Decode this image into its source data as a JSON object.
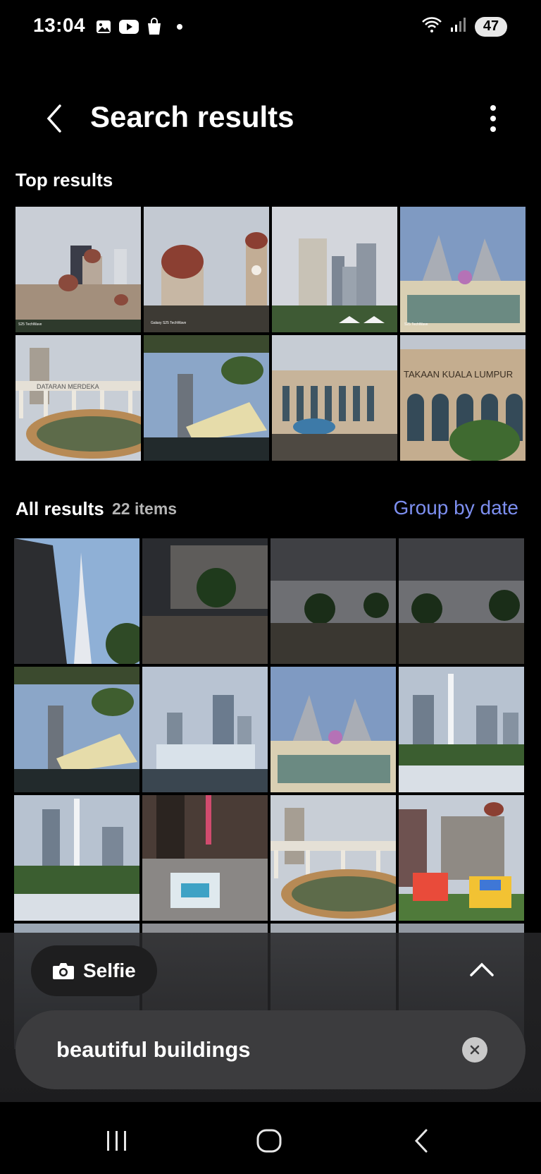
{
  "status": {
    "time": "13:04",
    "battery": "47",
    "left_icons": [
      "gallery-icon",
      "youtube-icon",
      "shop-icon",
      "dot-icon"
    ],
    "right_icons": [
      "wifi-icon",
      "signal-icon"
    ]
  },
  "header": {
    "title": "Search results",
    "back_icon": "chevron-left-icon",
    "more_icon": "more-vertical-icon"
  },
  "top_results": {
    "title": "Top results",
    "photos": [
      "Sultan Abdul Samad building with clock tower",
      "Red dome and clock tower",
      "City skyscrapers",
      "Petronas Twin Towers from below",
      "Dataran Merdeka colonnade and fountain",
      "Modern buildings with palm trees",
      "Perpustakaan Kuala Lumpur facade",
      "Perpustakaan Kuala Lumpur arches"
    ],
    "watermark": "Galaxy S25 TechWave"
  },
  "all_results": {
    "title": "All results",
    "count": "22 items",
    "group_label": "Group by date",
    "photos": [
      "Tower spire and angular building",
      "Night plaza with mall",
      "Night plaza with trees",
      "Night plaza with trees 2",
      "Modern buildings with palm trees",
      "KLCC fountain",
      "Petronas Twin Towers",
      "Fountain with skyline",
      "Fountain with skyline 2",
      "Mall interior atrium",
      "Dataran Merdeka colonnade",
      "Bouncy castle near clock tower",
      "Partial row 1",
      "Partial row 2",
      "Partial row 3",
      "Partial row 4"
    ]
  },
  "bottom": {
    "chip_label": "Selfie",
    "chip_icon": "camera-icon",
    "expand_icon": "chevron-up-icon",
    "search_value": "beautiful buildings",
    "clear_icon": "clear-icon"
  },
  "navbar": {
    "icons": [
      "recent-apps-icon",
      "home-icon",
      "back-icon"
    ]
  },
  "colors": {
    "background": "#000000",
    "accent": "#7d8ff0",
    "search_pill": "#3c3c3e"
  }
}
